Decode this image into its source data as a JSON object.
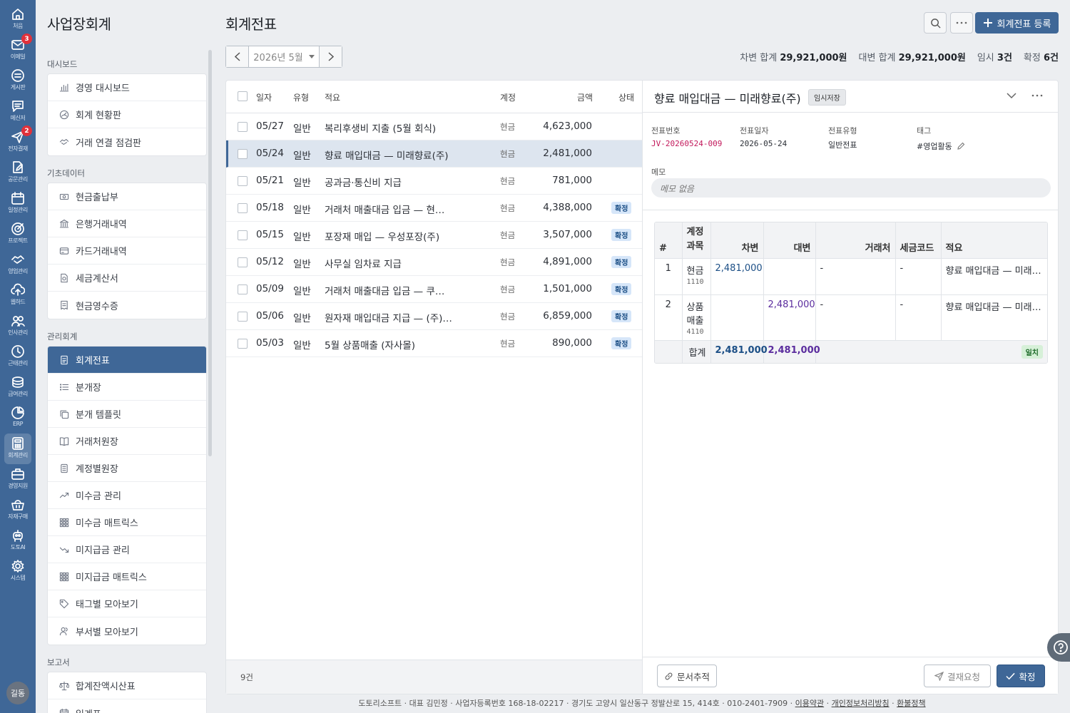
{
  "rail": {
    "items": [
      {
        "label": "처음",
        "icon": "home-icon"
      },
      {
        "label": "이메일",
        "icon": "mail-icon",
        "badge": "3"
      },
      {
        "label": "게시판",
        "icon": "board-icon"
      },
      {
        "label": "메신저",
        "icon": "messenger-icon"
      },
      {
        "label": "전자결재",
        "icon": "approval-icon",
        "badge": "2"
      },
      {
        "label": "공문관리",
        "icon": "document-edit-icon"
      },
      {
        "label": "일정관리",
        "icon": "calendar-icon"
      },
      {
        "label": "프로젝트",
        "icon": "target-icon"
      },
      {
        "label": "영업관리",
        "icon": "handshake-icon"
      },
      {
        "label": "웹하드",
        "icon": "cloud-upload-icon"
      },
      {
        "label": "인사관리",
        "icon": "people-icon"
      },
      {
        "label": "근태관리",
        "icon": "clock-icon"
      },
      {
        "label": "급여관리",
        "icon": "coins-icon"
      },
      {
        "label": "ERP",
        "icon": "pie-chart-icon"
      },
      {
        "label": "회계관리",
        "icon": "calculator-icon"
      },
      {
        "label": "경영지원",
        "icon": "briefcase-icon"
      },
      {
        "label": "자재구매",
        "icon": "basket-icon"
      },
      {
        "label": "도토AI",
        "icon": "robot-icon"
      },
      {
        "label": "시스템",
        "icon": "gear-icon"
      }
    ],
    "avatar": "길동"
  },
  "sidebar": {
    "title": "사업장회계",
    "sections": [
      {
        "title": "대시보드",
        "items": [
          {
            "label": "경영 대시보드",
            "icon": "bar-chart-icon"
          },
          {
            "label": "회계 현황판",
            "icon": "gauge-icon"
          },
          {
            "label": "거래 연결 점검판",
            "icon": "handshake-icon"
          }
        ]
      },
      {
        "title": "기초데이터",
        "items": [
          {
            "label": "현금출납부",
            "icon": "cash-icon"
          },
          {
            "label": "은행거래내역",
            "icon": "bank-icon"
          },
          {
            "label": "카드거래내역",
            "icon": "card-icon"
          },
          {
            "label": "세금계산서",
            "icon": "invoice-icon"
          },
          {
            "label": "현금영수증",
            "icon": "receipt-icon"
          }
        ]
      },
      {
        "title": "관리회계",
        "items": [
          {
            "label": "회계전표",
            "icon": "voucher-icon",
            "active": true
          },
          {
            "label": "분개장",
            "icon": "list-icon"
          },
          {
            "label": "분개 템플릿",
            "icon": "copy-icon"
          },
          {
            "label": "거래처원장",
            "icon": "book-icon"
          },
          {
            "label": "계정별원장",
            "icon": "ledger-icon"
          },
          {
            "label": "미수금 관리",
            "icon": "trend-up-icon"
          },
          {
            "label": "미수금 매트릭스",
            "icon": "grid-icon"
          },
          {
            "label": "미지급금 관리",
            "icon": "trend-down-icon"
          },
          {
            "label": "미지급금 매트릭스",
            "icon": "grid-icon"
          },
          {
            "label": "태그별 모아보기",
            "icon": "tag-icon"
          },
          {
            "label": "부서별 모아보기",
            "icon": "users-icon"
          }
        ]
      },
      {
        "title": "보고서",
        "items": [
          {
            "label": "합계잔액시산표",
            "icon": "scale-icon"
          },
          {
            "label": "일계표",
            "icon": "calendar-icon"
          }
        ]
      }
    ]
  },
  "header": {
    "title": "회계전표",
    "register_label": "회계전표 등록",
    "month": "2026년 5월",
    "totals": {
      "debit_label": "차변 합계",
      "debit_value": "29,921,000원",
      "credit_label": "대변 합계",
      "credit_value": "29,921,000원",
      "draft_label": "임시",
      "draft_value": "3건",
      "confirmed_label": "확정",
      "confirmed_value": "6건"
    }
  },
  "list": {
    "columns": {
      "date": "일자",
      "type": "유형",
      "desc": "적요",
      "account": "계정",
      "amount": "금액",
      "status": "상태"
    },
    "rows": [
      {
        "date": "05/27",
        "type": "일반",
        "desc": "복리후생비 지출 (5월 회식)",
        "account": "현금",
        "amount": "4,623,000",
        "status": ""
      },
      {
        "date": "05/24",
        "type": "일반",
        "desc": "향료 매입대금 — 미래향료(주)",
        "account": "현금",
        "amount": "2,481,000",
        "status": "",
        "selected": true
      },
      {
        "date": "05/21",
        "type": "일반",
        "desc": "공과금·통신비 지급",
        "account": "현금",
        "amount": "781,000",
        "status": ""
      },
      {
        "date": "05/18",
        "type": "일반",
        "desc": "거래처 매출대금 입금 — 현…",
        "account": "현금",
        "amount": "4,388,000",
        "status": "확정"
      },
      {
        "date": "05/15",
        "type": "일반",
        "desc": "포장재 매입 — 우성포장(주)",
        "account": "현금",
        "amount": "3,507,000",
        "status": "확정"
      },
      {
        "date": "05/12",
        "type": "일반",
        "desc": "사무실 임차료 지급",
        "account": "현금",
        "amount": "4,891,000",
        "status": "확정"
      },
      {
        "date": "05/09",
        "type": "일반",
        "desc": "거래처 매출대금 입금 — 쿠…",
        "account": "현금",
        "amount": "1,501,000",
        "status": "확정"
      },
      {
        "date": "05/06",
        "type": "일반",
        "desc": "원자재 매입대금 지급 — (주)…",
        "account": "현금",
        "amount": "6,859,000",
        "status": "확정"
      },
      {
        "date": "05/03",
        "type": "일반",
        "desc": "5월 상품매출 (자사몰)",
        "account": "현금",
        "amount": "890,000",
        "status": "확정"
      }
    ],
    "count": "9건"
  },
  "detail": {
    "title": "향료 매입대금 — 미래향료(주)",
    "status": "임시저장",
    "meta": {
      "no_label": "전표번호",
      "no_value": "JV-20260524-009",
      "date_label": "전표일자",
      "date_value": "2026-05-24",
      "type_label": "전표유형",
      "type_value": "일반전표",
      "tag_label": "태그",
      "tag_value": "#영업활동"
    },
    "memo_label": "메모",
    "memo_value": "메모 없음",
    "table": {
      "headers": {
        "no": "#",
        "account": "계정 과목",
        "debit": "차변",
        "credit": "대변",
        "partner": "거래처",
        "tax": "세금코드",
        "desc": "적요"
      },
      "rows": [
        {
          "no": "1",
          "account": "현금",
          "code": "1110",
          "debit": "2,481,000",
          "credit": "",
          "partner": "-",
          "tax": "-",
          "desc": "향료 매입대금 — 미래…"
        },
        {
          "no": "2",
          "account": "상품 매출",
          "code": "4110",
          "debit": "",
          "credit": "2,481,000",
          "partner": "-",
          "tax": "-",
          "desc": "향료 매입대금 — 미래…"
        }
      ],
      "sum_label": "합계",
      "sum_debit": "2,481,000",
      "sum_credit": "2,481,000",
      "match_label": "일치"
    },
    "buttons": {
      "trace": "문서추적",
      "approval": "결재요청",
      "confirm": "확정"
    }
  },
  "footer": {
    "text": "도토리소프트 · 대표 김민정 · 사업자등록번호 168-18-02217 · 경기도 고양시 일산동구 정발산로 15, 414호 · 010-2401-7909 ·",
    "terms": "이용약관",
    "privacy": "개인정보처리방침",
    "refund": "환불정책"
  },
  "colors": {
    "primary": "#3f6797",
    "badge_red": "#e0313b",
    "confirmed_badge": "#d6e6f9",
    "match_badge": "#d6f0d8"
  }
}
